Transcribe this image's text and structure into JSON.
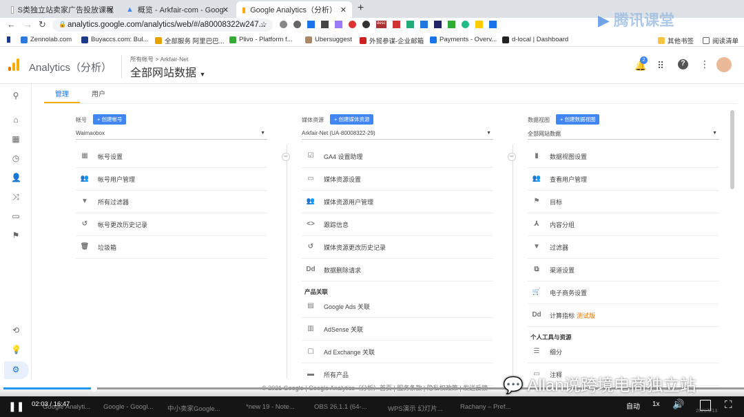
{
  "browser": {
    "tabs": [
      {
        "title": "S类独立站卖家广告投放课程"
      },
      {
        "title": "概览 - Arkfair-com - Google Ads"
      },
      {
        "title": "Google Analytics（分析）"
      }
    ],
    "new_tab": "+",
    "url": "analytics.google.com/analytics/web/#/a80008322w247...",
    "bookmarks": [
      "Zennolab.com",
      "Buyaccs.com: Bul...",
      "全部服务 阿里巴巴...",
      "Plivo - Platform f...",
      "Ubersuggest",
      "外贸参谋-企业邮箱",
      "Payments - Overv...",
      "d-local | Dashboard"
    ],
    "other_bookmarks": "其他书签",
    "reading_list": "阅读清单",
    "extension_badge": "desc"
  },
  "ga": {
    "product": "Analytics（分析）",
    "breadcrumb": "所有帐号 > Arkfair-Net",
    "view_title": "全部网站数据",
    "notif_count": "2",
    "tabs": [
      "管理",
      "用户"
    ],
    "footer": "© 2021 Google | Google Analytics（分析）首页 | 服务条款 | 隐私权政策 | 发送反馈"
  },
  "account": {
    "label": "帐号",
    "create": "创建帐号",
    "selected": "Waimaobox",
    "items": [
      {
        "icon": "building-icon",
        "glyph": "▦",
        "label": "帐号设置"
      },
      {
        "icon": "users-icon",
        "glyph": "👥",
        "label": "帐号用户管理"
      },
      {
        "icon": "filter-icon",
        "glyph": "▼",
        "label": "所有过滤器"
      },
      {
        "icon": "history-icon",
        "glyph": "↺",
        "label": "帐号更改历史记录"
      },
      {
        "icon": "trash-icon",
        "glyph": "🗑",
        "label": "垃圾箱"
      }
    ]
  },
  "property": {
    "label": "媒体资源",
    "create": "创建媒体资源",
    "selected": "Arkfair-Net (UA-80008322-29)",
    "items": [
      {
        "icon": "checkbox-icon",
        "glyph": "☑",
        "label": "GA4 设置助理"
      },
      {
        "icon": "window-icon",
        "glyph": "▭",
        "label": "媒体资源设置"
      },
      {
        "icon": "users-icon",
        "glyph": "👥",
        "label": "媒体资源用户管理"
      },
      {
        "icon": "code-icon",
        "glyph": "<>",
        "label": "跟踪信息"
      },
      {
        "icon": "history-icon",
        "glyph": "↺",
        "label": "媒体资源更改历史记录"
      },
      {
        "icon": "dd-icon",
        "glyph": "Dd",
        "label": "数据删除请求"
      }
    ],
    "section": "产品关联",
    "links": [
      {
        "icon": "google-ads-icon",
        "glyph": "▤",
        "label": "Google Ads 关联"
      },
      {
        "icon": "adsense-icon",
        "glyph": "▥",
        "label": "AdSense 关联"
      },
      {
        "icon": "ad-exchange-icon",
        "glyph": "▢",
        "label": "Ad Exchange 关联"
      },
      {
        "icon": "all-products-icon",
        "glyph": "▬",
        "label": "所有产品"
      }
    ]
  },
  "view": {
    "label": "数据视图",
    "create": "创建数据视图",
    "selected": "全部网站数据",
    "items": [
      {
        "icon": "document-icon",
        "glyph": "▮",
        "label": "数据视图设置"
      },
      {
        "icon": "users-icon",
        "glyph": "👥",
        "label": "查看用户管理"
      },
      {
        "icon": "flag-icon",
        "glyph": "⚑",
        "label": "目标"
      },
      {
        "icon": "content-grouping-icon",
        "glyph": "⅄",
        "label": "内容分组"
      },
      {
        "icon": "filter-icon",
        "glyph": "▼",
        "label": "过滤器"
      },
      {
        "icon": "channel-icon",
        "glyph": "⧉",
        "label": "渠道设置"
      },
      {
        "icon": "cart-icon",
        "glyph": "🛒",
        "label": "电子商务设置"
      },
      {
        "icon": "dd-icon",
        "glyph": "Dd",
        "label": "计算指标",
        "badge": "测试版"
      }
    ],
    "section": "个人工具与资源",
    "tools": [
      {
        "icon": "segments-icon",
        "glyph": "☰",
        "label": "细分"
      },
      {
        "icon": "annotations-icon",
        "glyph": "▭",
        "label": "注释"
      }
    ]
  },
  "player": {
    "time": "02:03 / 16:47",
    "progress": 0.122,
    "quality": "自动",
    "speed": "1x",
    "watermark": "Allan说跨境电商独立站",
    "logo": "腾讯课堂",
    "taskbar": [
      "Google Analyti...",
      "Google - Googl...",
      "中小卖家Google...",
      "*new 19 - Note...",
      "OBS 26.1.1 (64-...",
      "WPS演示 幻灯片...",
      "Rachany – Pref..."
    ],
    "date": "2021/5/13"
  }
}
